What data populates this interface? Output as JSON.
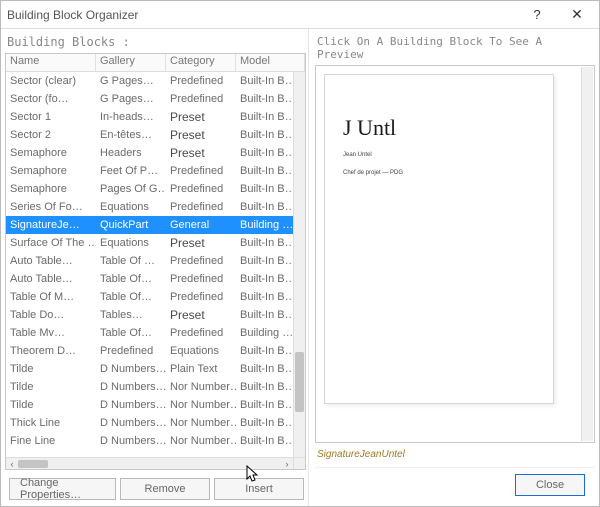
{
  "title": "Building Block Organizer",
  "left_label": "Building Blocks :",
  "right_label": "Click On A Building Block To See A Preview",
  "columns": {
    "name": "Name",
    "gallery": "Gallery",
    "category": "Category",
    "model": "Model"
  },
  "rows": [
    {
      "name": "Sector (clear)",
      "gallery": "G Pages…",
      "category": "Predefined",
      "model": "Built-In B…"
    },
    {
      "name": "Sector (fo…",
      "gallery": "G Pages…",
      "category": "Predefined",
      "model": "Built-In B…"
    },
    {
      "name": "Sector 1",
      "gallery": "In-heads…",
      "category": "Preset",
      "model": "Built-In B…",
      "preset": true
    },
    {
      "name": "Sector 2",
      "gallery": "En-têtes…",
      "category": "Preset",
      "model": "Built-In B…",
      "preset": true
    },
    {
      "name": "Semaphore",
      "gallery": "Headers",
      "category": "Preset",
      "model": "Built-In B…",
      "preset": true
    },
    {
      "name": "Semaphore",
      "gallery": "Feet Of P…",
      "category": "Predefined",
      "model": "Built-In B…"
    },
    {
      "name": "Semaphore",
      "gallery": "Pages Of G…",
      "category": "Predefined",
      "model": "Built-In B…"
    },
    {
      "name": "Series Of Fo…",
      "gallery": "Equations",
      "category": "Predefined",
      "model": "Built-In B…"
    },
    {
      "name": "SignatureJe…",
      "gallery": "QuickPart",
      "category": "General",
      "model": "Building …",
      "selected": true
    },
    {
      "name": "Surface Of The …",
      "gallery": "Equations",
      "category": "Preset",
      "model": "Built-In B…",
      "preset": true
    },
    {
      "name": "Auto Table…",
      "gallery": "Table Of …",
      "category": "Predefined",
      "model": "Built-In B…"
    },
    {
      "name": "Auto Table…",
      "gallery": "Table Of…",
      "category": "Predefined",
      "model": "Built-In B…"
    },
    {
      "name": "Table Of M…",
      "gallery": "Table Of…",
      "category": "Predefined",
      "model": "Built-In B…"
    },
    {
      "name": "Table Do…",
      "gallery": "Tables…",
      "category": "Preset",
      "model": "Built-In B…",
      "preset": true
    },
    {
      "name": "Table Mv…",
      "gallery": "Table Of…",
      "category": "Predefined",
      "model": "Building …"
    },
    {
      "name": "Theorem D…",
      "gallery": "Predefined",
      "category": "Equations",
      "model": "Built-In B…"
    },
    {
      "name": "Tilde",
      "gallery": "D Numbers…",
      "category": "Plain Text",
      "model": "Built-In B…"
    },
    {
      "name": "Tilde",
      "gallery": "D Numbers…",
      "category": "Nor Number…",
      "model": "Built-In B…"
    },
    {
      "name": "Tilde",
      "gallery": "D Numbers…",
      "category": "Nor Number…",
      "model": "Built-In B…"
    },
    {
      "name": "Thick Line",
      "gallery": "D Numbers…",
      "category": "Nor Number…",
      "model": "Built-In B…"
    },
    {
      "name": "Fine Line",
      "gallery": "D Numbers…",
      "category": "Nor Number…",
      "model": "Built-In B…"
    }
  ],
  "buttons": {
    "change": "Change Properties…",
    "remove": "Remove",
    "insert": "Insert",
    "close": "Close"
  },
  "preview": {
    "signature": "J Untl",
    "line1": "Jean Untel",
    "line2": "Chef de projet — PDG",
    "caption": "SignatureJeanUntel"
  }
}
